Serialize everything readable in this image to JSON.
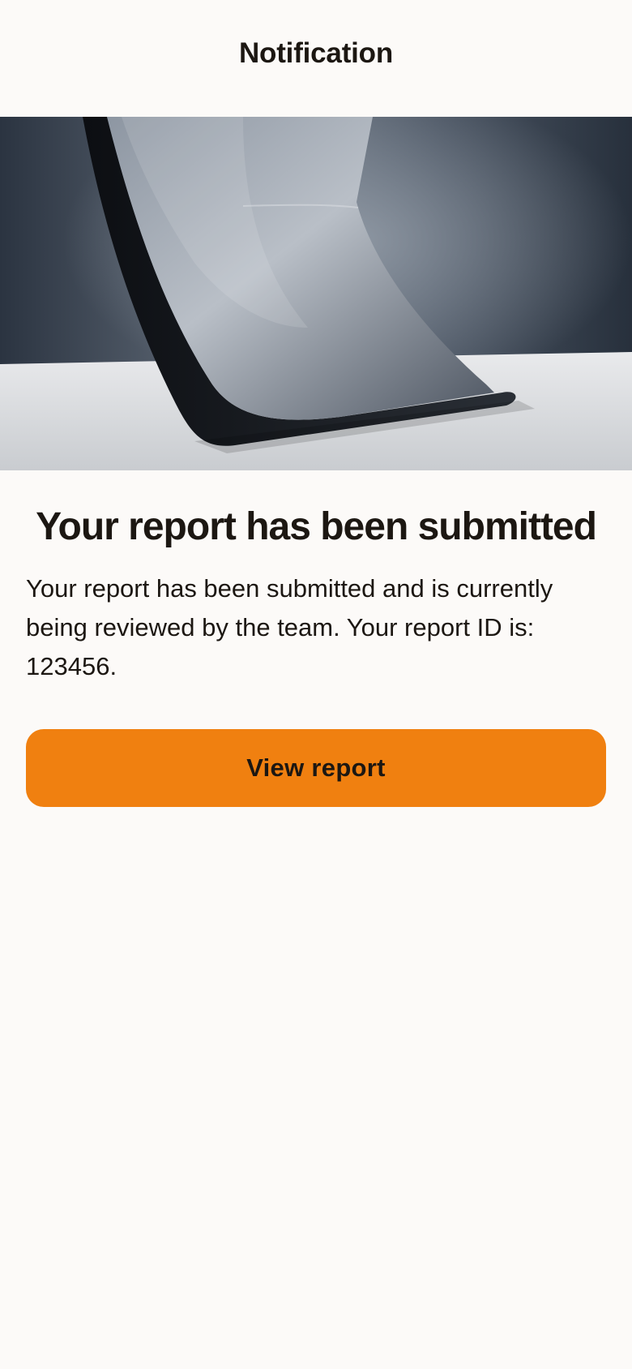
{
  "header": {
    "title": "Notification"
  },
  "hero": {
    "icon": "laptop-screen-photo"
  },
  "main": {
    "headline": "Your report has been submitted",
    "body": "Your report has been submitted and is currently being reviewed by the team. Your report ID is: 123456.",
    "cta_label": "View report"
  },
  "colors": {
    "background": "#fcfaf8",
    "accent": "#f08010",
    "text": "#1c1712"
  }
}
